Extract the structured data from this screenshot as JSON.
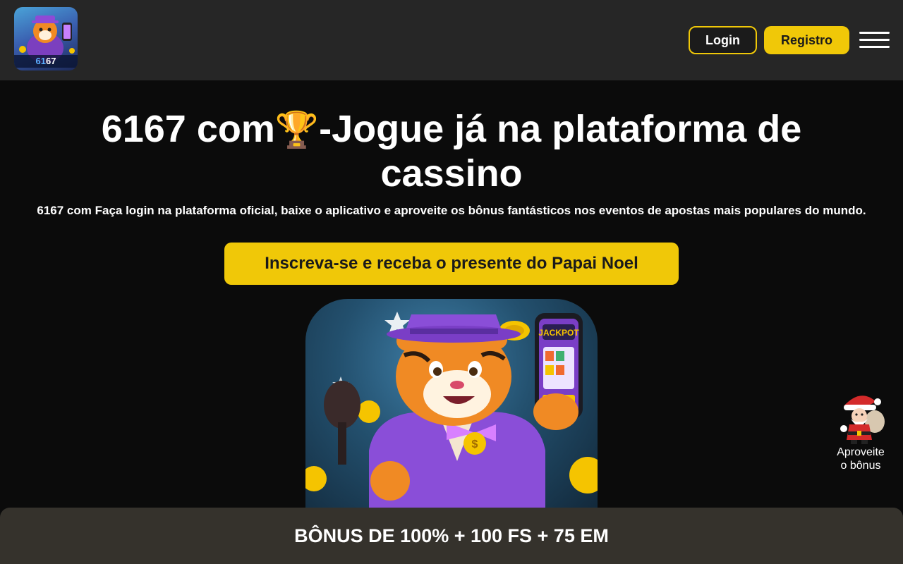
{
  "header": {
    "logo_text_prefix": "61",
    "logo_text_suffix": "67",
    "login_label": "Login",
    "register_label": "Registro"
  },
  "hero": {
    "title_part1": "6167 com",
    "title_trophy": "🏆",
    "title_part2": "-Jogue já na plataforma de cassino",
    "subtitle": "6167 com Faça login na plataforma oficial, baixe o aplicativo e aproveite os bônus fantásticos nos eventos de apostas mais populares do mundo.",
    "cta_label": "Inscreva-se e receba o presente do Papai Noel",
    "phone_text": "JACKPOT"
  },
  "santa_widget": {
    "label_line1": "Aproveite",
    "label_line2": "o bônus"
  },
  "bonus_bar": {
    "text": "BÔNUS DE 100% + 100 FS + 75 EM"
  },
  "colors": {
    "accent": "#f0c808",
    "header_bg": "#262626",
    "page_bg": "#0b0b0b",
    "bonus_bar_bg": "#35322c"
  }
}
